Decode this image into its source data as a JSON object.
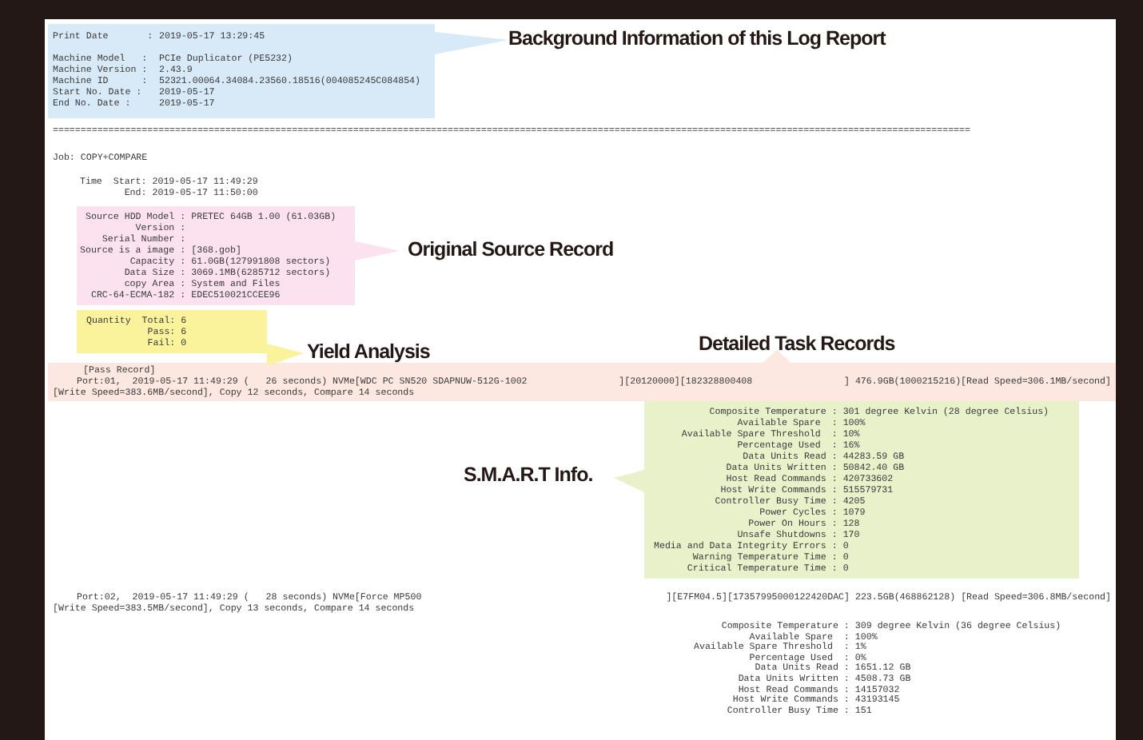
{
  "header": {
    "print_date": {
      "label": "Print Date       :",
      "value": "2019-05-17 13:29:45"
    },
    "rows": [
      {
        "label": "Machine Model   :",
        "value": "PCIe Duplicator (PE5232)"
      },
      {
        "label": "Machine Version :",
        "value": "2.43.9"
      },
      {
        "label": "Machine ID      :",
        "value": "52321.00064.34084.23560.18516(004085245C084854)"
      },
      {
        "label": "Start No. Date :",
        "value": "2019-05-17"
      },
      {
        "label": "End No. Date :",
        "value": "2019-05-17"
      }
    ]
  },
  "separator": "=====================================================================================================================================================================",
  "job": {
    "title": "Job: COPY+COMPARE",
    "time": [
      {
        "label": "Time  Start:",
        "value": "2019-05-17 11:49:29"
      },
      {
        "label": "End:",
        "value": "2019-05-17 11:50:00"
      }
    ]
  },
  "source_record": [
    {
      "label": "Source HDD Model :",
      "value": "PRETEC 64GB 1.00 (61.03GB)"
    },
    {
      "label": "Version :"
    },
    {
      "label": "Serial Number :"
    },
    {
      "label": "Source is a image :",
      "value": "[368.gob]"
    },
    {
      "label": "Capacity :",
      "value": "61.0GB(127991808 sectors)"
    },
    {
      "label": "Data Size :",
      "value": "3069.1MB(6285712 sectors)"
    },
    {
      "label": "copy Area :",
      "value": "System and Files"
    },
    {
      "label": "CRC-64-ECMA-182 :",
      "value": "EDEC510021CCEE96"
    }
  ],
  "yield": [
    {
      "label": "Quantity  Total:",
      "value": "6"
    },
    {
      "label": "Pass:",
      "value": "6"
    },
    {
      "label": "Fail:",
      "value": "0"
    }
  ],
  "pass_record": {
    "title": "[Pass Record]",
    "ports": [
      {
        "highlighted": true,
        "segments": [
          "Port:01,  2019-05-17 11:49:29 (   26 seconds) NVMe[WDC PC SN520 SDAPNUW-512G-1002",
          "][20120000][182328800408",
          "] 476.9GB(1000215216)[Read Speed=306.1MB/second]"
        ],
        "speed": "[Write Speed=383.6MB/second], Copy 12 seconds, Compare 14 seconds",
        "smart": {
          "highlighted": true,
          "rows": [
            {
              "label": "Composite Temperature :",
              "value": "301 degree Kelvin (28 degree Celsius)"
            },
            {
              "label": "Available Spare  :",
              "value": "100%"
            },
            {
              "label": "Available Spare Threshold  :",
              "value": "10%"
            },
            {
              "label": "Percentage Used  :",
              "value": "16%"
            },
            {
              "label": "Data Units Read :",
              "value": "44283.59 GB"
            },
            {
              "label": "Data Units Written :",
              "value": "50842.40 GB"
            },
            {
              "label": "Host Read Commands :",
              "value": "420733602"
            },
            {
              "label": "Host Write Commands :",
              "value": "515579731"
            },
            {
              "label": "Controller Busy Time :",
              "value": "4205"
            },
            {
              "label": "Power Cycles :",
              "value": "1079"
            },
            {
              "label": "Power On Hours :",
              "value": "128"
            },
            {
              "label": "Unsafe Shutdowns :",
              "value": "170"
            },
            {
              "label": "Media and Data Integrity Errors :",
              "value": "0"
            },
            {
              "label": "Warning Temperature Time :",
              "value": "0"
            },
            {
              "label": "Critical Temperature Time :",
              "value": "0"
            }
          ]
        }
      },
      {
        "highlighted": false,
        "segments": [
          "Port:02,  2019-05-17 11:49:29 (   28 seconds) NVMe[Force MP500",
          "][E7FM04.5][17357995000122420DAC] 223.5GB(468862128) [Read Speed=306.8MB/second]"
        ],
        "speed": "[Write Speed=383.5MB/second], Copy 13 seconds, Compare 14 seconds",
        "smart": {
          "highlighted": false,
          "rows": [
            {
              "label": "Composite Temperature :",
              "value": "309 degree Kelvin (36 degree Celsius)"
            },
            {
              "label": "Available Spare  :",
              "value": "100%"
            },
            {
              "label": "Available Spare Threshold  :",
              "value": "1%"
            },
            {
              "label": "Percentage Used  :",
              "value": "0%"
            },
            {
              "label": "Data Units Read :",
              "value": "1651.12 GB"
            },
            {
              "label": "Data Units Written :",
              "value": "4508.73 GB"
            },
            {
              "label": "Host Read Commands :",
              "value": "14157032"
            },
            {
              "label": "Host Write Commands :",
              "value": "43193145"
            },
            {
              "label": "Controller Busy Time :",
              "value": "151"
            }
          ]
        }
      }
    ]
  },
  "callouts": [
    {
      "kind": "header",
      "text": "Background Information of this Log Report"
    },
    {
      "kind": "source",
      "text": "Original Source Record"
    },
    {
      "kind": "yield",
      "text": "Yield Analysis"
    },
    {
      "kind": "tasks",
      "text": "Detailed Task Records"
    },
    {
      "kind": "smart",
      "text": "S.M.A.R.T Info."
    }
  ]
}
